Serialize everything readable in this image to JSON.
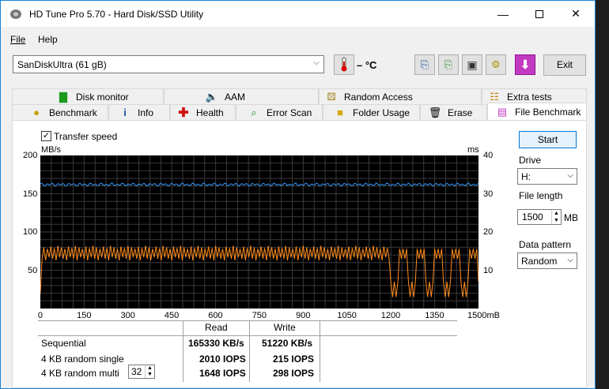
{
  "window": {
    "title": "HD Tune Pro 5.70 - Hard Disk/SSD Utility"
  },
  "menu": {
    "file": "File",
    "help": "Help"
  },
  "toolbar": {
    "drive": "SanDiskUltra (61 gB)",
    "temp": "– °C",
    "exit": "Exit"
  },
  "tabs_top": [
    "Disk monitor",
    "AAM",
    "Random Access",
    "Extra tests"
  ],
  "tabs_bottom": [
    "Benchmark",
    "Info",
    "Health",
    "Error Scan",
    "Folder Usage",
    "Erase",
    "File Benchmark"
  ],
  "options": {
    "transfer_speed": "Transfer speed",
    "start": "Start",
    "drive_label": "Drive",
    "drive_value": "H:",
    "file_length_label": "File length",
    "file_length_value": "1500",
    "file_length_unit": "MB",
    "data_pattern_label": "Data pattern",
    "data_pattern_value": "Random"
  },
  "results": {
    "read_header": "Read",
    "write_header": "Write",
    "rows": [
      {
        "label": "Sequential",
        "read": "165330 KB/s",
        "write": "51220 KB/s"
      },
      {
        "label": "4 KB random single",
        "read": "2010 IOPS",
        "write": "215 IOPS"
      },
      {
        "label": "4 KB random multi",
        "read": "1648 IOPS",
        "write": "298 IOPS"
      }
    ],
    "queue_depth": "32"
  },
  "chart_data": {
    "type": "line",
    "y_left_label": "MB/s",
    "y_right_label": "ms",
    "y_left_ticks": [
      "200",
      "150",
      "100",
      "50"
    ],
    "y_right_ticks": [
      "40",
      "30",
      "20",
      "10"
    ],
    "x_ticks": [
      "0",
      "150",
      "300",
      "450",
      "600",
      "750",
      "900",
      "1050",
      "1200",
      "1350",
      "1500mB"
    ],
    "xlim": [
      0,
      1500
    ],
    "ylim": [
      0,
      200
    ],
    "y2lim": [
      0,
      40
    ],
    "series": [
      {
        "color": "#3399ff",
        "axis": "left",
        "approx_value": 162
      },
      {
        "color": "#ff8c1a",
        "axis": "left",
        "range_first_part": [
          63,
          82
        ],
        "range_after_1200": [
          10,
          80
        ]
      }
    ],
    "grid": true
  }
}
